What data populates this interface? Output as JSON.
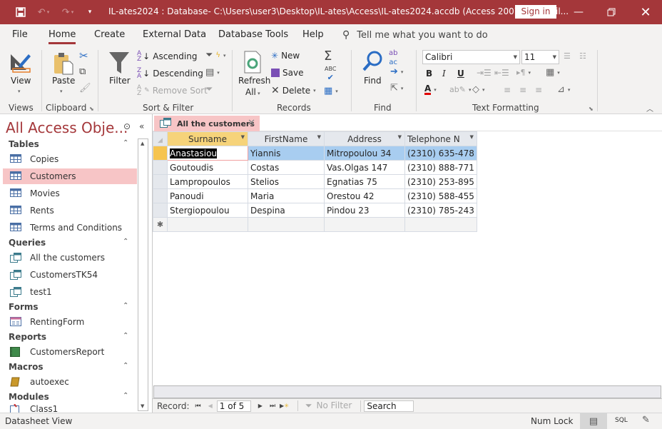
{
  "titlebar": {
    "title": "IL-ates2024 : Database- C:\\Users\\user3\\Desktop\\IL-ates\\Access\\IL-ates2024.accdb (Access 2007 - 2016 fil...",
    "sign_in": "Sign in",
    "icons": {
      "save": "save-icon",
      "undo": "undo-icon",
      "redo": "redo-icon",
      "customize": "customize-qat-icon",
      "minimize": "minimize-icon",
      "restore": "restore-icon",
      "close": "close-icon"
    }
  },
  "menu": {
    "tabs": [
      "File",
      "Home",
      "Create",
      "External Data",
      "Database Tools",
      "Help"
    ],
    "active": "Home",
    "tell_me": "Tell me what you want to do"
  },
  "ribbon": {
    "views": {
      "view": "View",
      "label": "Views"
    },
    "clipboard": {
      "paste": "Paste",
      "label": "Clipboard"
    },
    "sort_filter": {
      "filter": "Filter",
      "ascending": "Ascending",
      "descending": "Descending",
      "remove_sort": "Remove Sort",
      "label": "Sort & Filter"
    },
    "records": {
      "refresh": "Refresh",
      "all": "All",
      "new": "New",
      "save": "Save",
      "delete": "Delete",
      "label": "Records"
    },
    "find": {
      "find": "Find",
      "label": "Find"
    },
    "text_formatting": {
      "font": "Calibri",
      "size": "11",
      "bold": "B",
      "italic": "I",
      "underline": "U",
      "label": "Text Formatting",
      "font_color": "#e00000"
    }
  },
  "nav": {
    "title": "All Access Obje...",
    "sections": [
      {
        "name": "Tables",
        "items": [
          "Copies",
          "Customers",
          "Movies",
          "Rents",
          "Terms and Conditions"
        ]
      },
      {
        "name": "Queries",
        "items": [
          "All the customers",
          "CustomersTK54",
          "test1"
        ]
      },
      {
        "name": "Forms",
        "items": [
          "RentingForm"
        ]
      },
      {
        "name": "Reports",
        "items": [
          "CustomersReport"
        ]
      },
      {
        "name": "Macros",
        "items": [
          "autoexec"
        ]
      },
      {
        "name": "Modules",
        "items": [
          "Class1"
        ]
      }
    ],
    "selected": "Customers"
  },
  "document": {
    "tab": "All the customers",
    "columns": [
      "Surname",
      "FirstName",
      "Address",
      "Telephone N"
    ],
    "rows": [
      [
        "Anastasiou",
        "Yiannis",
        "Mitropoulou 34",
        "(2310) 635-478"
      ],
      [
        "Goutoudis",
        "Costas",
        "Vas.Olgas 147",
        "(2310) 888-771"
      ],
      [
        "Lampropoulos",
        "Stelios",
        "Egnatias 75",
        "(2310) 253-895"
      ],
      [
        "Panoudi",
        "Maria",
        "Orestou 42",
        "(2310) 588-455"
      ],
      [
        "Stergiopoulou",
        "Despina",
        "Pindou 23",
        "(2310) 785-243"
      ]
    ],
    "new_row_marker": "✱"
  },
  "record_nav": {
    "label": "Record:",
    "position": "1 of 5",
    "filter": "No Filter",
    "search": "Search"
  },
  "status": {
    "view": "Datasheet View",
    "num_lock": "Num Lock",
    "sql": "SQL"
  },
  "colors": {
    "accent": "#a4373a",
    "selection": "#f7c5c6",
    "row_highlight": "#a8cdf0",
    "header_selected": "#f6d37a"
  }
}
